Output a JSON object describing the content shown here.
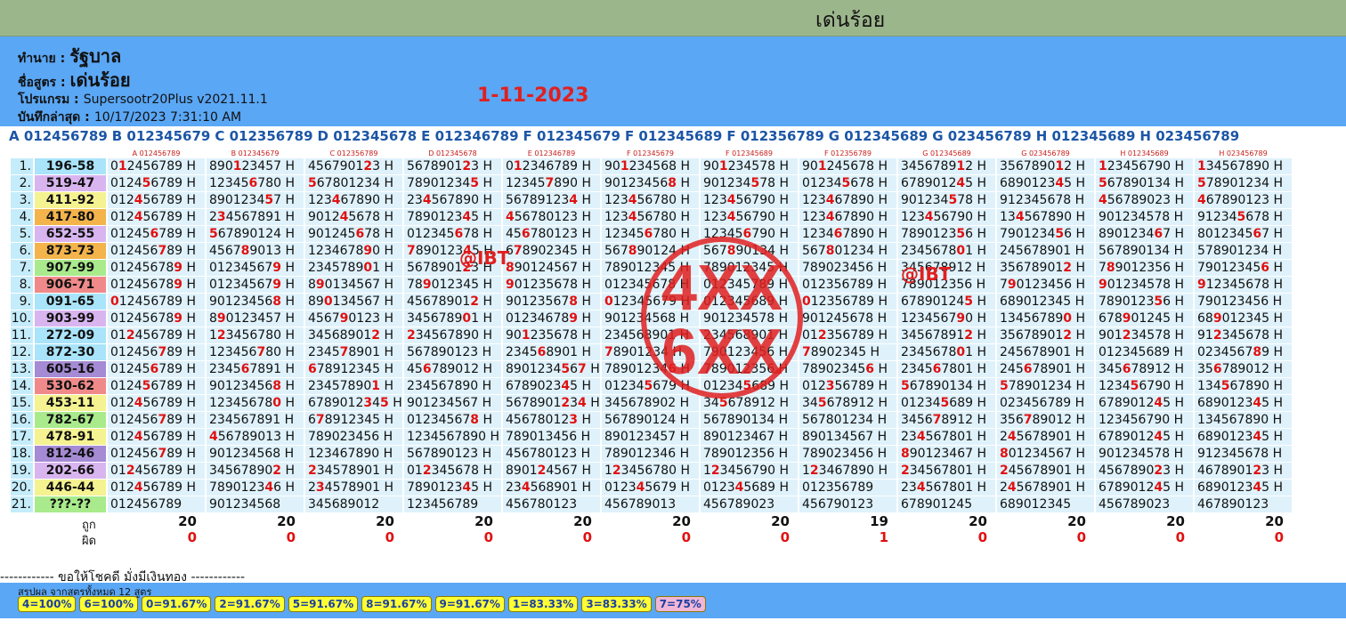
{
  "header": {
    "title": "เด่นร้อย"
  },
  "info": {
    "forecaster_label": "ทำนาย :",
    "forecaster_value": "รัฐบาล",
    "formula_label": "ชื่อสูตร :",
    "formula_value": "เด่นร้อย",
    "program_label": "โปรแกรม :",
    "program_value": "Supersootr20Plus v2021.11.1",
    "saved_label": "บันทึกล่าสุด :",
    "saved_value": "10/17/2023 7:31:10 AM",
    "date": "1-11-2023"
  },
  "formulas": [
    "A 012456789",
    "B 012345679",
    "C 012356789",
    "D 012345678",
    "E 012346789",
    "F 012345679",
    "F 012345689",
    "F 012356789",
    "G 012345689",
    "G 023456789",
    "H 012345689",
    "H 023456789"
  ],
  "rows": [
    {
      "i": "1.",
      "n": "196-58",
      "c": "#a9e4fa",
      "cells": [
        "0[1]2456789 H",
        "890[1]23457 H",
        "4567901[2]3 H",
        "5678901[2]3 H",
        "0[1]2346789 H",
        "90[1]234568 H",
        "90[1]234578 H",
        "90[1]245678 H",
        "3456789[1]2 H",
        "3567890[1]2 H",
        "[1]23456790 H",
        "[1]34567890 H"
      ]
    },
    {
      "i": "2.",
      "n": "519-47",
      "c": "#d9b5f0",
      "cells": [
        "0124[5]6789 H",
        "12345[6]780 H",
        "[5]67801234 H",
        "78901234[5] H",
        "12345[7]890 H",
        "90123456[8] H",
        "901234[5]78 H",
        "01234[5]678 H",
        "6789012[4]5 H",
        "6890123[4]5 H",
        "[5]67890134 H",
        "[5]78901234 H"
      ]
    },
    {
      "i": "3.",
      "n": "411-92",
      "c": "#f5f291",
      "cells": [
        "012[4]56789 H",
        "8901234[5]7 H",
        "123[4]67890 H",
        "23[4]567890 H",
        "56789123[4] H",
        "123[4]56780 H",
        "123[4]56790 H",
        "123[4]67890 H",
        "901234[5]78 H",
        "912345678 H",
        "[4]56789023 H",
        "[4]67890123 H"
      ]
    },
    {
      "i": "4.",
      "n": "417-80",
      "c": "#f2b44b",
      "cells": [
        "012[4]56789 H",
        "2[3]4567891 H",
        "9012[4]5678 H",
        "7890123[4]5 H",
        "[4]56780123 H",
        "123[4]56780 H",
        "123[4]56790 H",
        "123[4]67890 H",
        "123[4]56790 H",
        "13[4]567890 H",
        "901234578 H",
        "91234[5]678 H"
      ]
    },
    {
      "i": "5.",
      "n": "652-55",
      "c": "#d9b5f0",
      "cells": [
        "01245[6]789 H",
        "[5]67890124 H",
        "901245[6]78 H",
        "012345[6]78 H",
        "45[6]780123 H",
        "12345[6]780 H",
        "12345[6]790 H",
        "1234[6]7890 H",
        "7890123[5]6 H",
        "7901234[5]6 H",
        "8901234[6]7 H",
        "8012345[6]7 H"
      ]
    },
    {
      "i": "6.",
      "n": "873-73",
      "c": "#f2b44b",
      "cells": [
        "012456[7]89 H",
        "4567[8]9013 H",
        "1234678[9]0 H",
        "[7]890123[4]5 H",
        "6[7]8902345 H",
        "567[8]90124 H",
        "567[8]90134 H",
        "567[8]01234 H",
        "2345678[0]1 H",
        "245678901 H",
        "567890134 H",
        "578901234 H"
      ]
    },
    {
      "i": "7.",
      "n": "907-99",
      "c": "#a9eb8c",
      "cells": [
        "01245678[9] H",
        "01234567[9] H",
        "2345789[0]1 H",
        "5678901[2]3 H",
        "[8]90124567 H",
        "789012345 H",
        "789012345 H",
        "789023456 H",
        "345678912 H",
        "35678901[2] H",
        "7[8]9012356 H",
        "79012345[6] H"
      ]
    },
    {
      "i": "8.",
      "n": "906-71",
      "c": "#f08a8a",
      "cells": [
        "01245678[9] H",
        "01234567[9] H",
        "8[9]0134567 H",
        "78[9]012345 H",
        "[9]01235678 H",
        "012345678 H",
        "012345789 H",
        "012356789 H",
        "789012356 H",
        "7[9]0123456 H",
        "[9]01234578 H",
        "[9]12345678 H"
      ]
    },
    {
      "i": "9.",
      "n": "091-65",
      "c": "#a9e4fa",
      "cells": [
        "[0]12456789 H",
        "90123456[8] H",
        "89[0]134567 H",
        "45678901[2] H",
        "90123567[8] H",
        "[0]12345679 H",
        "012345689 H",
        "[0]12356789 H",
        "67890124[5] H",
        "689012345 H",
        "7890123[5]6 H",
        "790123456 H"
      ]
    },
    {
      "i": "10.",
      "n": "903-99",
      "c": "#d9b5f0",
      "cells": [
        "01245678[9] H",
        "8[9]0123457 H",
        "4567[9]0123 H",
        "3456789[0]1 H",
        "01234678[9] H",
        "901234568 H",
        "901234578 H",
        "901245678 H",
        "1234567[9]0 H",
        "13456789[0] H",
        "678[9]01245 H",
        "68[9]012345 H"
      ]
    },
    {
      "i": "11.",
      "n": "272-09",
      "c": "#a9e4fa",
      "cells": [
        "01[2]456789 H",
        "1[2]3456780 H",
        "34568901[2] H",
        "[2]34567890 H",
        "90[1]235678 H",
        "234568901 H",
        "234568901 H",
        "01[2]356789 H",
        "34567891[2] H",
        "35678901[2] H",
        "901[2]34578 H",
        "91[2]345678 H"
      ]
    },
    {
      "i": "12.",
      "n": "872-30",
      "c": "#a9e4fa",
      "cells": [
        "012456[7]89 H",
        "123456[7]80 H",
        "2345[7]8901 H",
        "567890123 H",
        "2345[6]8901 H",
        "[7]8901234 H",
        "790123456 H",
        "[7]8902345 H",
        "2345678[0]1 H",
        "245678901 H",
        "012345689 H",
        "0234567[8]9 H"
      ]
    },
    {
      "i": "13.",
      "n": "605-16",
      "c": "#a58ad4",
      "cells": [
        "01245[6]789 H",
        "2345[6]7891 H",
        "[6]78912345 H",
        "45[6]789012 H",
        "8901234[5]6[7] H",
        "78901234[6] H",
        "789012356 H",
        "78902345[6] H",
        "2345[6]7801 H",
        "245[6]78901 H",
        "345[6]78912 H",
        "35[6]789012 H"
      ]
    },
    {
      "i": "14.",
      "n": "530-62",
      "c": "#f08a8a",
      "cells": [
        "0124[5]6789 H",
        "90123456[8] H",
        "23457890[1] H",
        "234567890 H",
        "6789023[4]5 H",
        "01234[5]679 H",
        "01234[5]689 H",
        "012[3]56789 H",
        "[5]67890134 H",
        "[5]78901234 H",
        "1234[5]6790 H",
        "134[5]67890 H"
      ]
    },
    {
      "i": "15.",
      "n": "453-11",
      "c": "#f5f291",
      "cells": [
        "012[4]56789 H",
        "12345678[0] H",
        "6789012[3]4[5] H",
        "901234567 H",
        "5678901[2]3[4] H",
        "345678902 H",
        "34[5]678912 H",
        "34[5]678912 H",
        "01234[5]689 H",
        "023456789 H",
        "6789012[4]5 H",
        "6890123[4]5 H"
      ]
    },
    {
      "i": "16.",
      "n": "782-67",
      "c": "#a9eb8c",
      "cells": [
        "012456[7]89 H",
        "234567891 H",
        "6[7]8912345 H",
        "01234567[8] H",
        "45678012[3] H",
        "567890124 H",
        "567890134 H",
        "567801234 H",
        "3456[7]8912 H",
        "356[7]89012 H",
        "123456790 H",
        "134567890 H"
      ]
    },
    {
      "i": "17.",
      "n": "478-91",
      "c": "#f5f291",
      "cells": [
        "012[4]56789 H",
        "[4]56789013 H",
        "789023456 H",
        "1234567890 H",
        "789013456 H",
        "890123457 H",
        "890123467 H",
        "890134567 H",
        "23[4]567801 H",
        "2[4]5678901 H",
        "6789012[4]5 H",
        "6890123[4]5 H"
      ]
    },
    {
      "i": "18.",
      "n": "812-46",
      "c": "#a58ad4",
      "cells": [
        "012456[7]89 H",
        "901234568 H",
        "123467890 H",
        "567890123 H",
        "456780123 H",
        "789012346 H",
        "789012356 H",
        "789023456 H",
        "[8]90123467 H",
        "[8]01234567 H",
        "901234578 H",
        "912345678 H"
      ]
    },
    {
      "i": "19.",
      "n": "202-66",
      "c": "#d9b5f0",
      "cells": [
        "01[2]456789 H",
        "34567890[2] H",
        "[2]34578901 H",
        "01[2]345678 H",
        "8901[2]4567 H",
        "1[2]3456780 H",
        "1[2]3456790 H",
        "1[2]3467890 H",
        "[2]34567801 H",
        "[2]45678901 H",
        "4567890[2]3 H",
        "4678901[2]3 H"
      ]
    },
    {
      "i": "20.",
      "n": "446-44",
      "c": "#f5f291",
      "cells": [
        "012[4]56789 H",
        "7890123[4]6 H",
        "2[3]4578901 H",
        "7890123[4]5 H",
        "23[4]568901 H",
        "0123[4]5679 H",
        "0123[4]5689 H",
        "012356789",
        "23[4]567801 H",
        "2[4]5678901 H",
        "6789012[4]5 H",
        "6890123[4]5 H"
      ]
    },
    {
      "i": "21.",
      "n": "???-??",
      "c": "#a9eb8c",
      "cells": [
        "012456789",
        "901234568",
        "345689012",
        "123456789",
        "456780123",
        "456789013",
        "456789023",
        "456790123",
        "678901245",
        "689012345",
        "456789023",
        "467890123"
      ]
    }
  ],
  "stats": {
    "hit_label": "ถูก",
    "miss_label": "ผิด",
    "hits": [
      "20",
      "20",
      "20",
      "20",
      "20",
      "20",
      "20",
      "19",
      "20",
      "20",
      "20",
      "20"
    ],
    "misses": [
      "0",
      "0",
      "0",
      "0",
      "0",
      "0",
      "0",
      "1",
      "0",
      "0",
      "0",
      "0"
    ]
  },
  "footer": {
    "luck_line": "------------ ขอให้โชคดี มั่งมีเงินทอง ------------",
    "summary_label": "สรุปผล จากสูตรทั้งหมด 12 สูตร",
    "chips": [
      "4=100%",
      "6=100%",
      "0=91.67%",
      "2=91.67%",
      "5=91.67%",
      "8=91.67%",
      "9=91.67%",
      "1=83.33%",
      "3=83.33%",
      "7=75%"
    ]
  },
  "watermarks": {
    "wm1": "@IBT",
    "wm2": "@IBT",
    "stamp_top": "4XX",
    "stamp_bottom": "6XX"
  },
  "colors": {
    "topbar": "#9cb68c",
    "info_bg": "#5aa7f5",
    "accent_red": "#e02020",
    "chip_bg": "#ffff33",
    "chip_last_bg": "#f0b6d8"
  }
}
